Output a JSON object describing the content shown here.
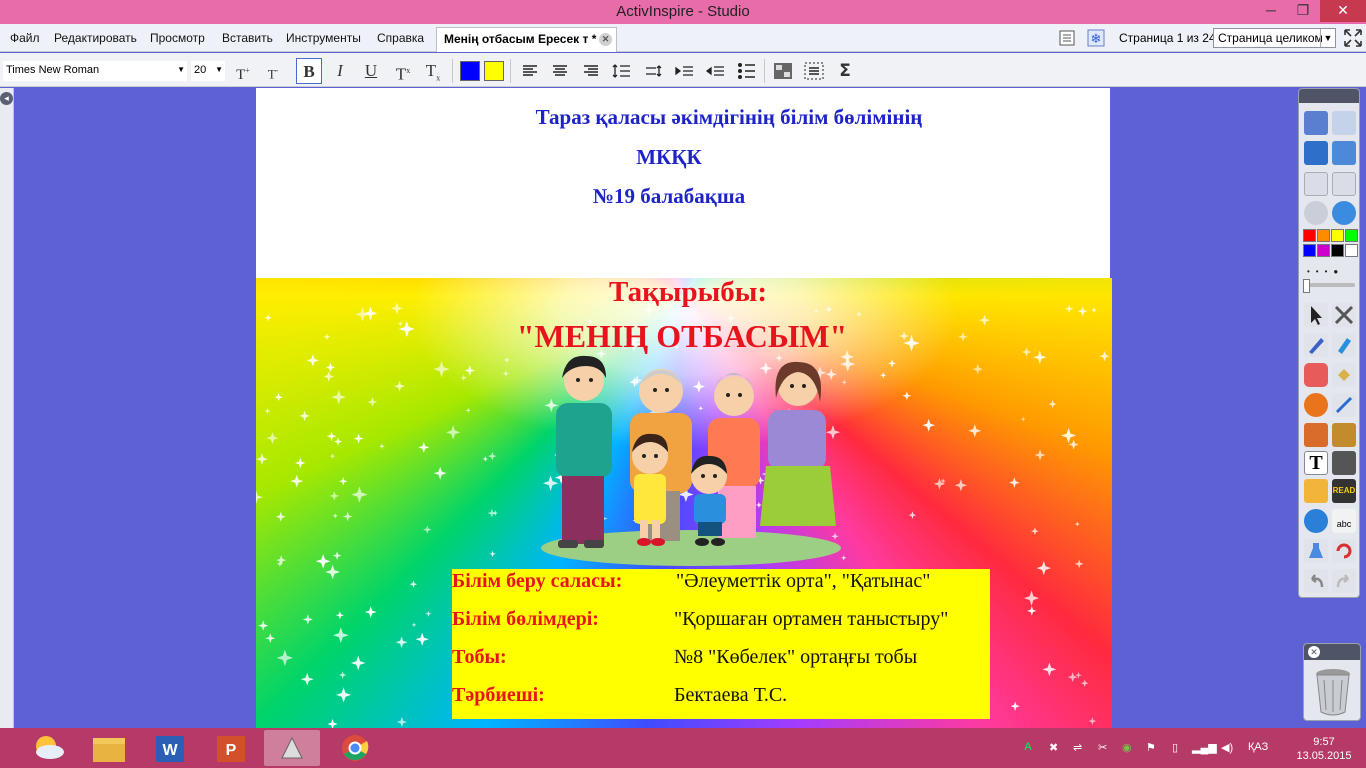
{
  "window": {
    "title": "ActivInspire - Studio",
    "min": "─",
    "max": "❐",
    "close": "✕"
  },
  "menu": {
    "items": [
      "Файл",
      "Редактировать",
      "Просмотр",
      "Вставить",
      "Инструменты",
      "Справка"
    ],
    "doc_tab": "Менің отбасым Ересек т *",
    "page_info": "Страница 1 из 24",
    "zoom": "Страница целиком"
  },
  "format": {
    "font": "Times New Roman",
    "size": "20",
    "bold": "B",
    "italic": "I",
    "underline": "U",
    "text_color": "#0000ff",
    "highlight_color": "#ffff00",
    "sigma": "Σ"
  },
  "page": {
    "header_lines": [
      "Тараз қаласы әкімдігінің білім бөлімінің",
      "МКҚК",
      "№19 балабақша"
    ],
    "topic_label": "Тақырыбы:",
    "topic_title": "\"МЕНІҢ ОТБАСЫМ\"",
    "info": [
      {
        "key": "Білім беру саласы:",
        "value": "\"Әлеуметтік орта\", \"Қатынас\""
      },
      {
        "key": "Білім бөлімдері:",
        "value": "\"Қоршаған ортамен таныстыру\""
      },
      {
        "key": "Тобы:",
        "value": "№8 \"Көбелек\" ортаңғы  тобы"
      },
      {
        "key": "Тәрбиеші:",
        "value": "Бектаева Т.С."
      }
    ]
  },
  "palette": [
    "#ff0000",
    "#ff8c00",
    "#ffff00",
    "#00ff00",
    "#0000ff",
    "#cc00cc",
    "#000000",
    "#ffffff"
  ],
  "taskbar": {
    "language": "ҚАЗ",
    "time": "9:57",
    "date": "13.05.2015"
  }
}
